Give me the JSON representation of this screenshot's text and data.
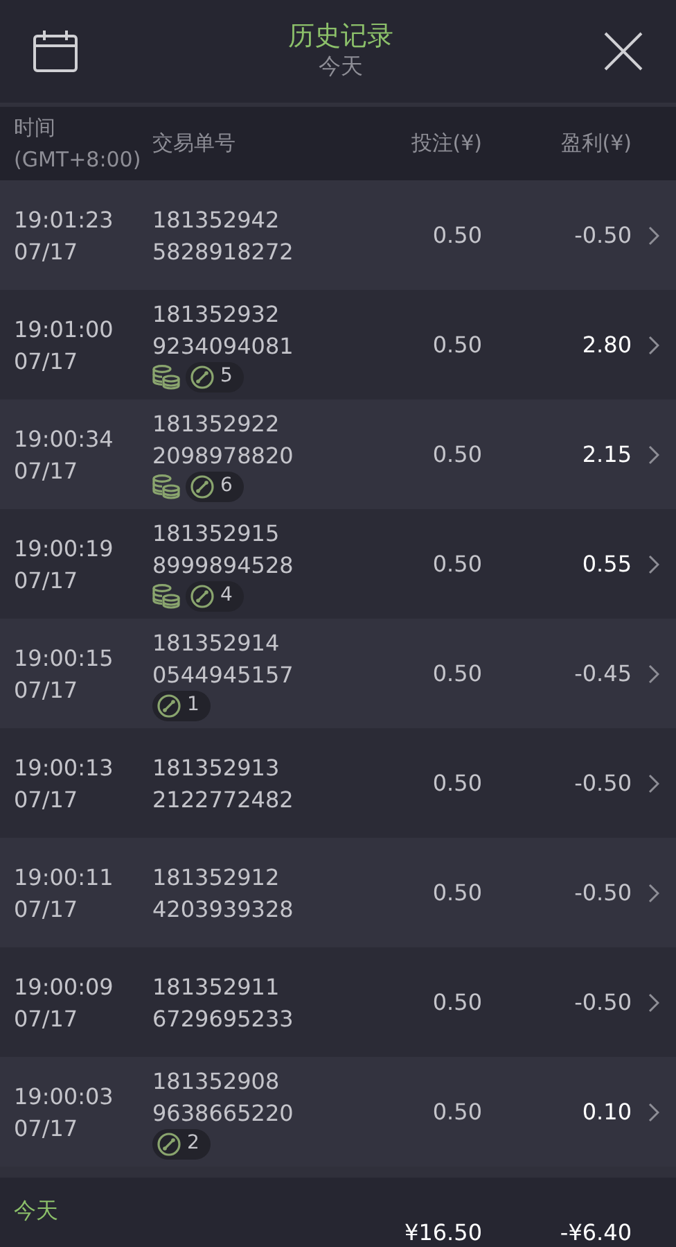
{
  "header": {
    "title": "历史记录",
    "subtitle": "今天"
  },
  "columns": [
    {
      "label": "时间",
      "sublabel": "(GMT+8:00)"
    },
    {
      "label": "交易单号"
    },
    {
      "label": "投注(¥)"
    },
    {
      "label": "盈利(¥)"
    }
  ],
  "rows": [
    {
      "time": "19:01:23",
      "date": "07/17",
      "order_line1": "181352942",
      "order_line2": "5828918272",
      "bet": "0.50",
      "profit": "-0.50",
      "win": false,
      "coins": false
    },
    {
      "time": "19:01:00",
      "date": "07/17",
      "order_line1": "181352932",
      "order_line2": "9234094081",
      "bet": "0.50",
      "profit": "2.80",
      "win": true,
      "coins": true,
      "badge": "5"
    },
    {
      "time": "19:00:34",
      "date": "07/17",
      "order_line1": "181352922",
      "order_line2": "2098978820",
      "bet": "0.50",
      "profit": "2.15",
      "win": true,
      "coins": true,
      "badge": "6"
    },
    {
      "time": "19:00:19",
      "date": "07/17",
      "order_line1": "181352915",
      "order_line2": "8999894528",
      "bet": "0.50",
      "profit": "0.55",
      "win": true,
      "coins": true,
      "badge": "4"
    },
    {
      "time": "19:00:15",
      "date": "07/17",
      "order_line1": "181352914",
      "order_line2": "0544945157",
      "bet": "0.50",
      "profit": "-0.45",
      "win": false,
      "coins": false,
      "badge": "1"
    },
    {
      "time": "19:00:13",
      "date": "07/17",
      "order_line1": "181352913",
      "order_line2": "2122772482",
      "bet": "0.50",
      "profit": "-0.50",
      "win": false,
      "coins": false
    },
    {
      "time": "19:00:11",
      "date": "07/17",
      "order_line1": "181352912",
      "order_line2": "4203939328",
      "bet": "0.50",
      "profit": "-0.50",
      "win": false,
      "coins": false
    },
    {
      "time": "19:00:09",
      "date": "07/17",
      "order_line1": "181352911",
      "order_line2": "6729695233",
      "bet": "0.50",
      "profit": "-0.50",
      "win": false,
      "coins": false
    },
    {
      "time": "19:00:03",
      "date": "07/17",
      "order_line1": "181352908",
      "order_line2": "9638665220",
      "bet": "0.50",
      "profit": "0.10",
      "win": true,
      "coins": false,
      "badge": "2"
    }
  ],
  "footer": {
    "period": "今天",
    "total_bet": "¥16.50",
    "total_profit": "-¥6.40"
  }
}
